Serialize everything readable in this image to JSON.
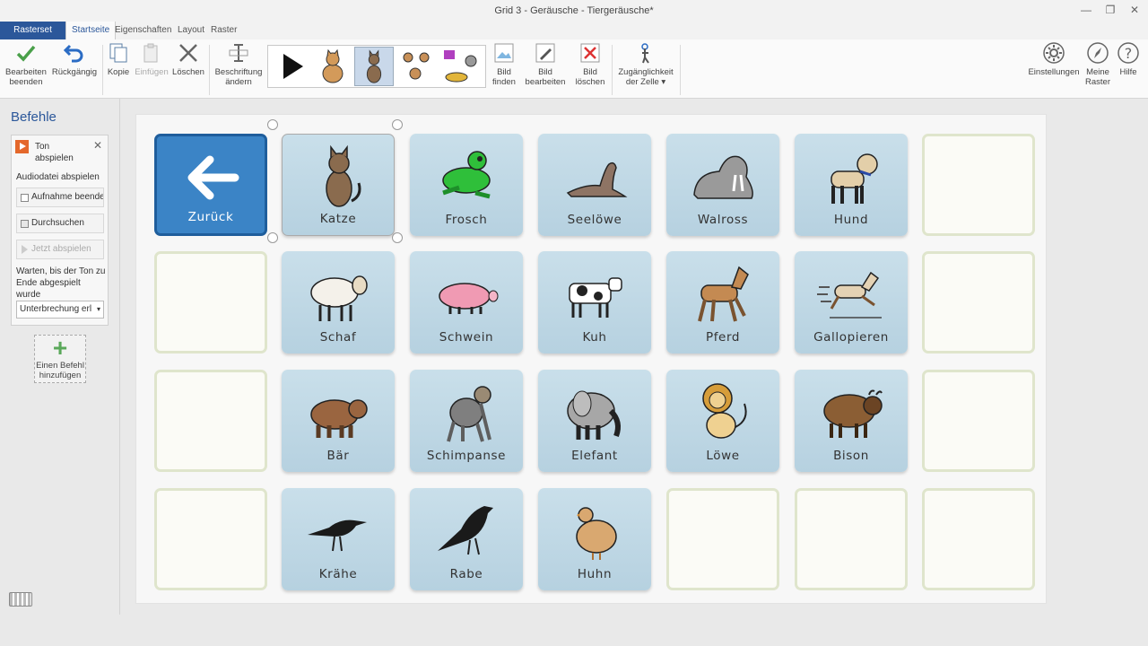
{
  "window": {
    "title": "Grid 3 - Geräusche - Tiergeräusche*"
  },
  "tabs": {
    "rasterset": "Rasterset",
    "startseite": "Startseite",
    "eigenschaften": "Eigenschaften",
    "layout": "Layout",
    "raster": "Raster"
  },
  "ribbon": {
    "bearbeiten_beenden": "Bearbeiten\nbeenden",
    "rueckgaengig": "Rückgängig",
    "kopie": "Kopie",
    "einfuegen": "Einfügen",
    "loeschen": "Löschen",
    "beschriftung": "Beschriftung\nändern",
    "bild_finden": "Bild\nfinden",
    "bild_bearbeiten": "Bild\nbearbeiten",
    "bild_loeschen": "Bild\nlöschen",
    "zugaenglichkeit": "Zugänglichkeit\nder Zelle ▾",
    "einstellungen": "Einstellungen",
    "meine_raster": "Meine\nRaster",
    "hilfe": "Hilfe"
  },
  "commands": {
    "title": "Befehle",
    "command_name": "Ton abspielen",
    "subtitle": "Audiodatei abspielen",
    "btn_aufnahme": "Aufnahme beenden",
    "btn_durchsuchen": "Durchsuchen",
    "btn_jetzt": "Jetzt abspielen",
    "wait_text": "Warten, bis der Ton zu Ende abgespielt wurde",
    "select_value": "Unterbrechung erl",
    "add_command": "Einen Befehl hinzufügen"
  },
  "grid": {
    "cells": [
      {
        "label": "Zurück",
        "icon": "back-arrow-icon"
      },
      {
        "label": "Katze",
        "icon": "cat-icon"
      },
      {
        "label": "Frosch",
        "icon": "frog-icon"
      },
      {
        "label": "Seelöwe",
        "icon": "sea-lion-icon"
      },
      {
        "label": "Walross",
        "icon": "walrus-icon"
      },
      {
        "label": "Hund",
        "icon": "dog-icon"
      },
      {
        "label": "Schaf",
        "icon": "sheep-icon"
      },
      {
        "label": "Schwein",
        "icon": "pig-icon"
      },
      {
        "label": "Kuh",
        "icon": "cow-icon"
      },
      {
        "label": "Pferd",
        "icon": "horse-icon"
      },
      {
        "label": "Gallopieren",
        "icon": "galloping-horse-icon"
      },
      {
        "label": "Bär",
        "icon": "bear-icon"
      },
      {
        "label": "Schimpanse",
        "icon": "chimpanzee-icon"
      },
      {
        "label": "Elefant",
        "icon": "elephant-icon"
      },
      {
        "label": "Löwe",
        "icon": "lion-icon"
      },
      {
        "label": "Bison",
        "icon": "bison-icon"
      },
      {
        "label": "Krähe",
        "icon": "crow-icon"
      },
      {
        "label": "Rabe",
        "icon": "raven-icon"
      },
      {
        "label": "Huhn",
        "icon": "hen-icon"
      }
    ]
  },
  "colors": {
    "accent": "#2b579a",
    "cell_bg": "#c9dfea",
    "back_cell": "#3b84c6",
    "empty_border": "#dfe5cc"
  }
}
